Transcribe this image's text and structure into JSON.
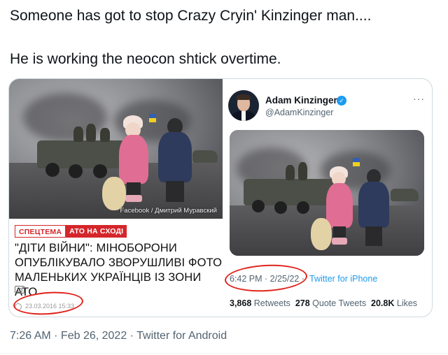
{
  "tweet": {
    "line1": "Someone has got to stop Crazy Cryin' Kinzinger man....",
    "line2": "He is working the neocon shtick overtime.",
    "meta": "7:26 AM · Feb 26, 2022 · Twitter for Android"
  },
  "news": {
    "photo_credit": "Facebook / Дмитрий Муравский",
    "tag1": "СПЕЦТЕМА",
    "tag2": "АТО НА СХОДІ",
    "headline": "\"ДІТИ ВІЙНИ\": МІНОБОРОНИ ОПУБЛІКУВАЛО ЗВОРУШЛИВІ ФОТО МАЛЕНЬКИХ УКРАЇНЦІВ ІЗ ЗОНИ АТО",
    "date": "23.03.2016 15:33",
    "icons": [
      "camera-icon",
      "clock-icon"
    ]
  },
  "embed": {
    "author_name": "Adam Kinzinger",
    "author_handle": "@AdamKinzinger",
    "more": "···",
    "time": "6:42 PM · 2/25/22 ·",
    "source": "Twitter for iPhone",
    "retweets_count": "3,868",
    "retweets_label": "Retweets",
    "quote_count": "278",
    "quote_label": "Quote Tweets",
    "likes_count": "20.8K",
    "likes_label": "Likes"
  },
  "colors": {
    "accent": "#1d9bf0",
    "annotation": "#e0241c",
    "tag_red": "#d5262b"
  }
}
